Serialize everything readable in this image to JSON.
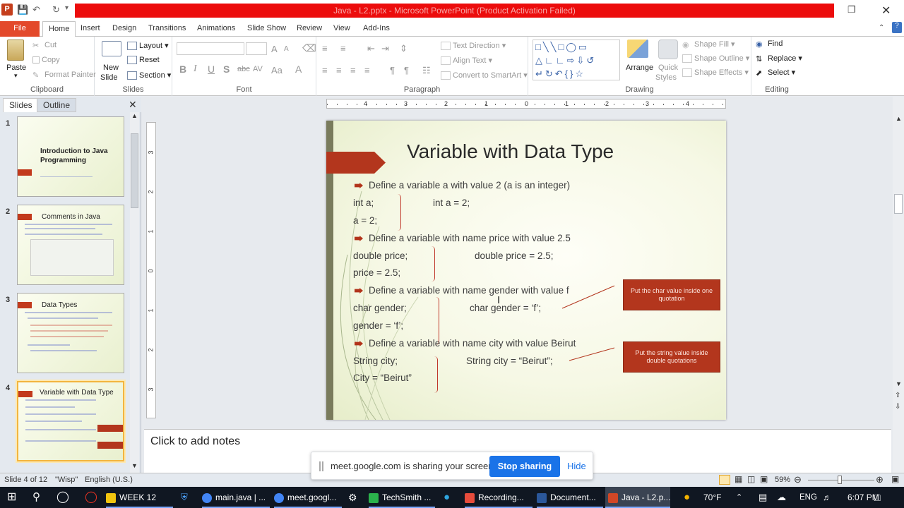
{
  "window": {
    "title": "Java - L2.pptx - Microsoft PowerPoint (Product Activation Failed)",
    "app_logo": "P"
  },
  "ribbon_tabs": [
    "File",
    "Home",
    "Insert",
    "Design",
    "Transitions",
    "Animations",
    "Slide Show",
    "Review",
    "View",
    "Add-Ins"
  ],
  "ribbon": {
    "clipboard": {
      "paste": "Paste",
      "cut": "Cut",
      "copy": "Copy",
      "format_painter": "Format Painter",
      "label": "Clipboard"
    },
    "slides": {
      "new_slide_1": "New",
      "new_slide_2": "Slide",
      "layout": "Layout",
      "reset": "Reset",
      "section": "Section",
      "label": "Slides"
    },
    "font": {
      "bold": "B",
      "italic": "I",
      "underline": "U",
      "shadow": "S",
      "strike": "abc",
      "spacing": "AV",
      "case": "Aa",
      "color": "A",
      "grow": "A",
      "shrink": "A",
      "label": "Font"
    },
    "paragraph": {
      "text_direction": "Text Direction",
      "align_text": "Align Text",
      "smartart": "Convert to SmartArt",
      "label": "Paragraph"
    },
    "drawing": {
      "arrange": "Arrange",
      "quick_styles_1": "Quick",
      "quick_styles_2": "Styles",
      "shape_fill": "Shape Fill",
      "shape_outline": "Shape Outline",
      "shape_effects": "Shape Effects",
      "label": "Drawing"
    },
    "editing": {
      "find": "Find",
      "replace": "Replace",
      "select": "Select",
      "label": "Editing"
    }
  },
  "left_pane": {
    "tabs": [
      "Slides",
      "Outline"
    ],
    "thumbnails": [
      {
        "num": "1",
        "title": "Introduction to Java Programming"
      },
      {
        "num": "2",
        "title": "Comments in Java"
      },
      {
        "num": "3",
        "title": "Data Types"
      },
      {
        "num": "4",
        "title": "Variable with Data Type"
      }
    ]
  },
  "ruler": {
    "h_ticks": [
      "4",
      "3",
      "2",
      "1",
      "0",
      "1",
      "2",
      "3",
      "4"
    ],
    "v_ticks": [
      "3",
      "2",
      "1",
      "0",
      "1",
      "2",
      "3"
    ]
  },
  "slide": {
    "title": "Variable with Data Type",
    "bullets": [
      "Define a variable a with value 2 (a is an integer)",
      "Define a variable with name price with value 2.5",
      "Define a variable with name gender with value f",
      "Define a variable with name city with value Beirut"
    ],
    "lines": {
      "a1": "int a;",
      "a2": "a = 2;",
      "a3": "int a = 2;",
      "p1": "double price;",
      "p2": "price = 2.5;",
      "p3": "double price = 2.5;",
      "g1": "char gender;",
      "g2": "gender = ‘f’;",
      "g3": "char gender = ‘f’;",
      "c1": "String city;",
      "c2": "City = “Beirut”",
      "c3": "String city = “Beirut”;"
    },
    "callouts": [
      "Put the char value inside one quotation",
      "Put the string value inside double quotations"
    ]
  },
  "notes": {
    "placeholder": "Click to add notes"
  },
  "share_bar": {
    "message": "meet.google.com is sharing your screen.",
    "stop": "Stop sharing",
    "hide": "Hide"
  },
  "status": {
    "slide": "Slide 4 of 12",
    "theme": "\"Wisp\"",
    "language": "English (U.S.)",
    "zoom": "59%",
    "zoom_value": 59
  },
  "taskbar": {
    "items": [
      "WEEK 12",
      "main.java | ...",
      "meet.googl...",
      "TechSmith ...",
      "Recording...",
      "Document...",
      "Java - L2.p..."
    ],
    "weather": "70°F",
    "lang": "ENG",
    "time": "6:07 PM"
  },
  "colors": {
    "accent_red": "#b3361d",
    "title_bar_red": "#ec0c0c",
    "file_tab": "#e3492b",
    "share_blue": "#1a73e8"
  }
}
